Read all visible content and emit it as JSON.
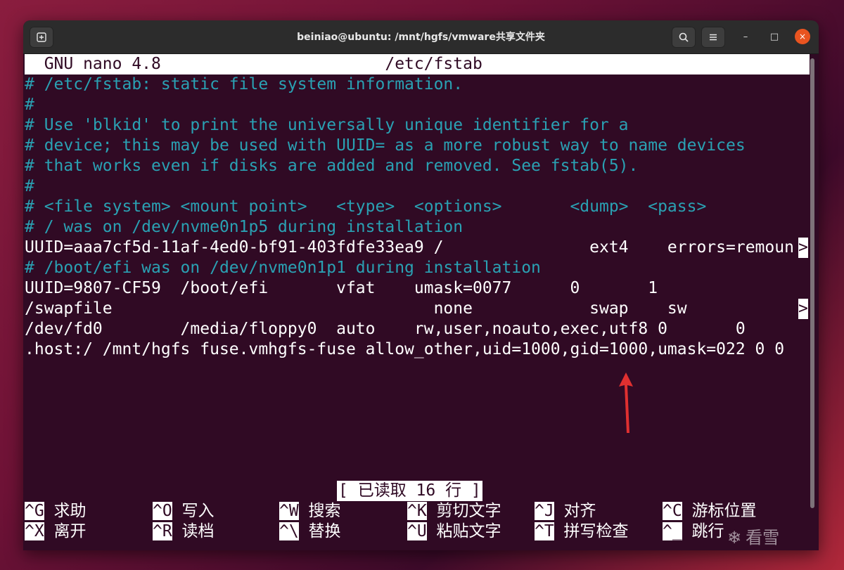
{
  "window": {
    "title": "beiniao@ubuntu: /mnt/hgfs/vmware共享文件夹",
    "new_tab_icon": "new-tab-icon",
    "search_icon": "search-icon",
    "menu_icon": "hamburger-menu-icon",
    "minimize": "–",
    "maximize": "□",
    "close": "×"
  },
  "nano": {
    "header": "  GNU nano 4.8                       /etc/fstab                                ",
    "lines": [
      {
        "text": "# /etc/fstab: static file system information.",
        "comment": true
      },
      {
        "text": "#",
        "comment": true
      },
      {
        "text": "# Use 'blkid' to print the universally unique identifier for a",
        "comment": true
      },
      {
        "text": "# device; this may be used with UUID= as a more robust way to name devices",
        "comment": true
      },
      {
        "text": "# that works even if disks are added and removed. See fstab(5).",
        "comment": true
      },
      {
        "text": "#",
        "comment": true
      },
      {
        "text": "# <file system> <mount point>   <type>  <options>       <dump>  <pass>",
        "comment": true
      },
      {
        "text": "# / was on /dev/nvme0n1p5 during installation",
        "comment": true
      },
      {
        "text": "UUID=aaa7cf5d-11af-4ed0-bf91-403fdfe33ea9 /               ext4    errors=remoun",
        "comment": false,
        "overflow": ">"
      },
      {
        "text": "# /boot/efi was on /dev/nvme0n1p1 during installation",
        "comment": true
      },
      {
        "text": "UUID=9807-CF59  /boot/efi       vfat    umask=0077      0       1",
        "comment": false
      },
      {
        "text": "/swapfile                                 none            swap    sw",
        "comment": false,
        "overflow": ">"
      },
      {
        "text": "/dev/fd0        /media/floppy0  auto    rw,user,noauto,exec,utf8 0       0",
        "comment": false
      },
      {
        "text": ".host:/ /mnt/hgfs fuse.vmhgfs-fuse allow_other,uid=1000,gid=1000,umask=022 0 0",
        "comment": false
      }
    ],
    "status": "[ 已读取 16 行 ]",
    "shortcuts_row1": [
      {
        "key": "^G",
        "label": "求助"
      },
      {
        "key": "^O",
        "label": "写入"
      },
      {
        "key": "^W",
        "label": "搜索"
      },
      {
        "key": "^K",
        "label": "剪切文字"
      },
      {
        "key": "^J",
        "label": "对齐"
      },
      {
        "key": "^C",
        "label": "游标位置"
      }
    ],
    "shortcuts_row2": [
      {
        "key": "^X",
        "label": "离开"
      },
      {
        "key": "^R",
        "label": "读档"
      },
      {
        "key": "^\\",
        "label": "替换"
      },
      {
        "key": "^U",
        "label": "粘贴文字"
      },
      {
        "key": "^T",
        "label": "拼写检查"
      },
      {
        "key": "^_",
        "label": "跳行"
      }
    ]
  },
  "watermark": "看雪",
  "colors": {
    "terminal_bg": "#300a24",
    "comment": "#2aa1b3",
    "arrow": "#e03030"
  }
}
